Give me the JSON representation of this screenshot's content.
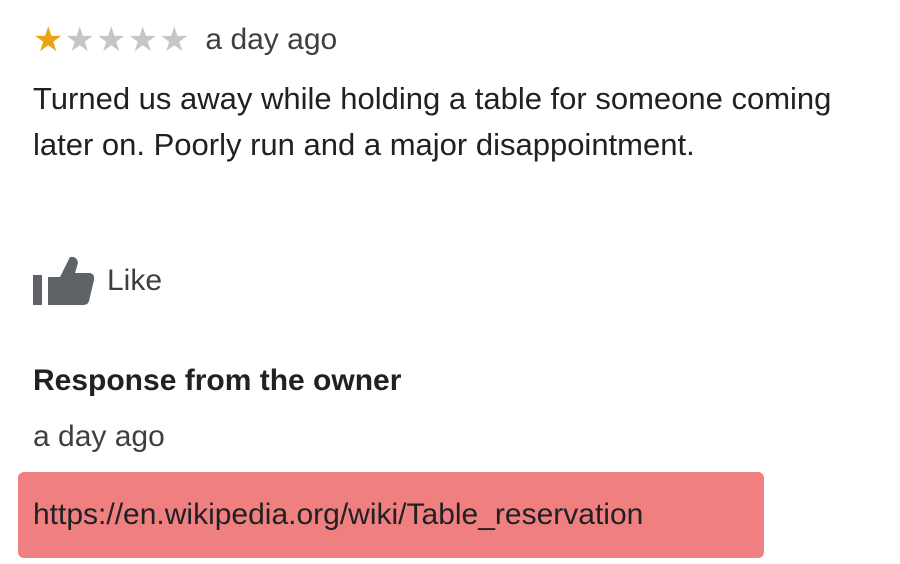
{
  "review": {
    "rating": 1,
    "max_rating": 5,
    "star_filled_color": "#e8a317",
    "star_empty_color": "#c6c6c6",
    "time": "a day ago",
    "text": "Turned us away while holding a table for someone coming later on. Poorly run and a major disappointment."
  },
  "actions": {
    "like_icon": "thumbs-up-icon",
    "like_label": "Like"
  },
  "owner_response": {
    "heading": "Response from the owner",
    "time": "a day ago",
    "link_text": "https://en.wikipedia.org/wiki/Table_reservation",
    "highlight_color": "#f07f80"
  }
}
